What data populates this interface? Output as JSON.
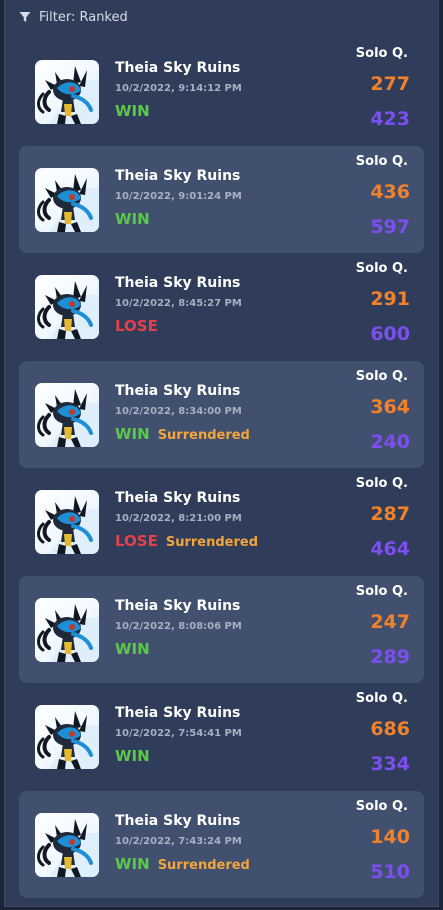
{
  "filter": {
    "label": "Filter: Ranked",
    "icon": "filter-icon"
  },
  "colors": {
    "win": "#5cc84b",
    "lose": "#e8404a",
    "surrendered": "#f2a53b",
    "value1": "#f0822c",
    "value2": "#7c4ff0"
  },
  "matches": [
    {
      "map": "Theia Sky Ruins",
      "time": "10/2/2022, 9:14:12 PM",
      "outcome": "WIN",
      "surrendered": "",
      "queue": "Solo Q.",
      "value1": "277",
      "value2": "423"
    },
    {
      "map": "Theia Sky Ruins",
      "time": "10/2/2022, 9:01:24 PM",
      "outcome": "WIN",
      "surrendered": "",
      "queue": "Solo Q.",
      "value1": "436",
      "value2": "597"
    },
    {
      "map": "Theia Sky Ruins",
      "time": "10/2/2022, 8:45:27 PM",
      "outcome": "LOSE",
      "surrendered": "",
      "queue": "Solo Q.",
      "value1": "291",
      "value2": "600"
    },
    {
      "map": "Theia Sky Ruins",
      "time": "10/2/2022, 8:34:00 PM",
      "outcome": "WIN",
      "surrendered": "Surrendered",
      "queue": "Solo Q.",
      "value1": "364",
      "value2": "240"
    },
    {
      "map": "Theia Sky Ruins",
      "time": "10/2/2022, 8:21:00 PM",
      "outcome": "LOSE",
      "surrendered": "Surrendered",
      "queue": "Solo Q.",
      "value1": "287",
      "value2": "464"
    },
    {
      "map": "Theia Sky Ruins",
      "time": "10/2/2022, 8:08:06 PM",
      "outcome": "WIN",
      "surrendered": "",
      "queue": "Solo Q.",
      "value1": "247",
      "value2": "289"
    },
    {
      "map": "Theia Sky Ruins",
      "time": "10/2/2022, 7:54:41 PM",
      "outcome": "WIN",
      "surrendered": "",
      "queue": "Solo Q.",
      "value1": "686",
      "value2": "334"
    },
    {
      "map": "Theia Sky Ruins",
      "time": "10/2/2022, 7:43:24 PM",
      "outcome": "WIN",
      "surrendered": "Surrendered",
      "queue": "Solo Q.",
      "value1": "140",
      "value2": "510"
    }
  ]
}
